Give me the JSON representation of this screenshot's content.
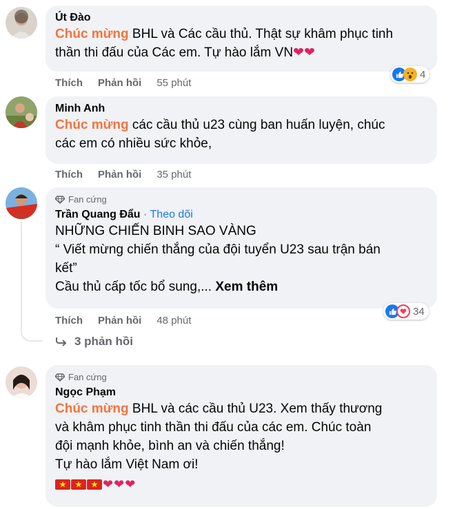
{
  "comments": [
    {
      "name": "Út Đào",
      "highlight": "Chúc mừng",
      "text_line1": " BHL và Các cầu thủ. Thật sự khâm phục tinh",
      "text_line2": "thần thi đấu của Các em. Tự hào lắm VN",
      "actions": {
        "like": "Thích",
        "reply": "Phản hồi",
        "time": "55 phút"
      },
      "reaction_count": "4"
    },
    {
      "name": "Minh Anh",
      "highlight": "Chúc mừng",
      "text_line1": " các cầu thủ u23 cùng ban huấn luyện, chúc",
      "text_line2": "các em có nhiều sức khỏe,",
      "actions": {
        "like": "Thích",
        "reply": "Phản hồi",
        "time": "35 phút"
      }
    },
    {
      "badge": "Fan cứng",
      "name": "Trần Quang Đẩu",
      "follow": "· Theo dõi",
      "line1": "NHỮNG CHIẾN BINH SAO VÀNG",
      "line2": "“ Viết mừng chiến thắng của đội tuyển U23 sau trận bán",
      "line3": "kết”",
      "line4": "Cầu thủ cấp tốc bổ sung,...",
      "see_more": "Xem thêm",
      "actions": {
        "like": "Thích",
        "reply": "Phản hồi",
        "time": "48 phút"
      },
      "reaction_count": "34",
      "replies": "3 phản hồi"
    },
    {
      "badge": "Fan cứng",
      "name": "Ngọc Phạm",
      "highlight": "Chúc mừng",
      "line1": " BHL và các cầu thủ U23. Xem thấy thương",
      "line2": "và khâm phục tinh thần thi đấu của các em. Chúc toàn",
      "line3": "đội mạnh khỏe, bình an và chiến thắng!",
      "line4": "Tự hào lắm Việt Nam ơi!"
    }
  ],
  "colors": {
    "highlight": "#f5733d",
    "link": "#1877f2",
    "bubble": "#f0f2f5",
    "meta": "#65676b"
  }
}
